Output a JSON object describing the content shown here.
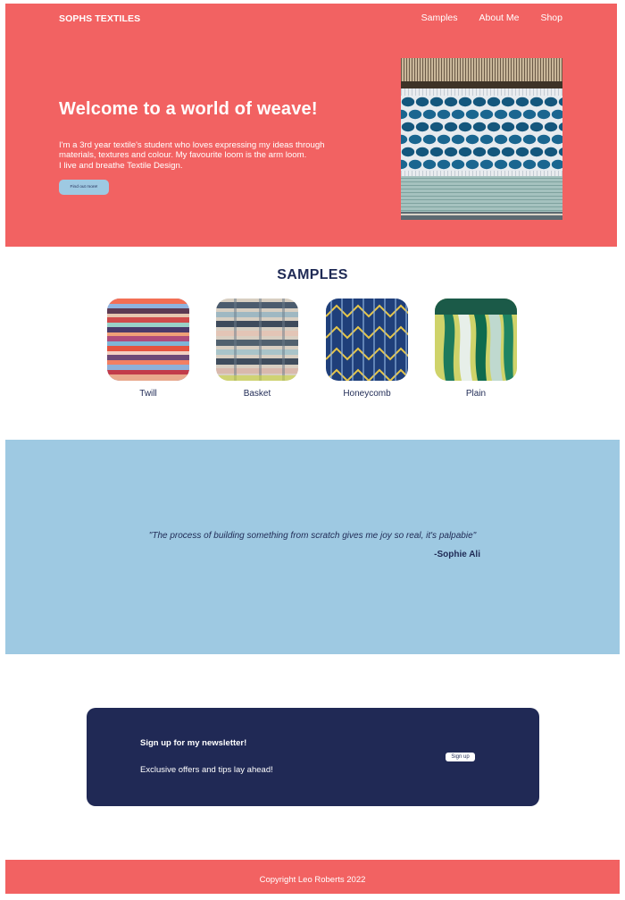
{
  "header": {
    "brand": "SOPHS TEXTILES",
    "nav": [
      "Samples",
      "About Me",
      "Shop"
    ]
  },
  "hero": {
    "title": "Welcome to a world of weave!",
    "lines": [
      "I'm a 3rd year textile's student who loves expressing my ideas through",
      "materials, textures and colour. My favourite loom is the arm loom.",
      "I live and breathe Textile Design."
    ],
    "button_label": "Find out more!"
  },
  "samples": {
    "title": "SAMPLES",
    "items": [
      {
        "label": "Twill"
      },
      {
        "label": "Basket"
      },
      {
        "label": "Honeycomb"
      },
      {
        "label": "Plain"
      }
    ]
  },
  "quote": {
    "text": "\"The process of building something from scratch gives me joy so real, it's palpabie\"",
    "author": "-Sophie Ali"
  },
  "newsletter": {
    "title": "Sign up for my newsletter!",
    "subtitle": "Exclusive offers and tips lay ahead!",
    "button_label": "Sign up"
  },
  "footer": {
    "copyright": "Copyright Leo Roberts 2022"
  },
  "colors": {
    "coral": "#f26262",
    "navy": "#202955",
    "light_blue": "#9ec9e2"
  }
}
